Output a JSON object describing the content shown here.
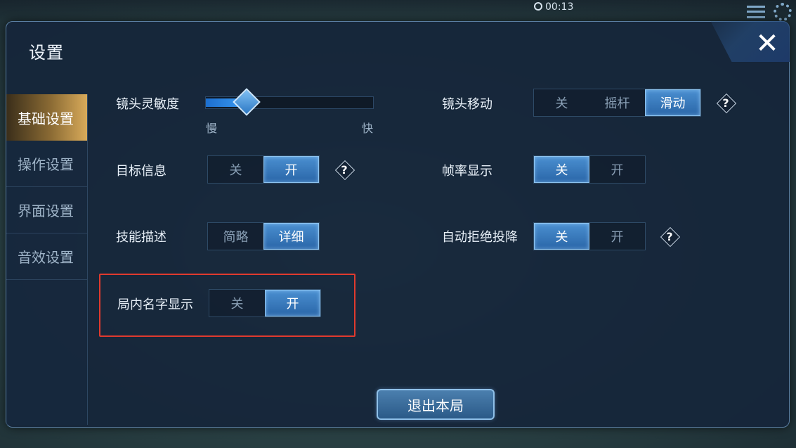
{
  "hud": {
    "timer": "00:13"
  },
  "dialog": {
    "title": "设置",
    "close_label": "✕"
  },
  "sidebar": {
    "items": [
      {
        "label": "基础设置",
        "active": true
      },
      {
        "label": "操作设置",
        "active": false
      },
      {
        "label": "界面设置",
        "active": false
      },
      {
        "label": "音效设置",
        "active": false
      }
    ]
  },
  "settings": {
    "camera_sensitivity": {
      "label": "镜头灵敏度",
      "min_label": "慢",
      "max_label": "快",
      "value": 0.2
    },
    "camera_move": {
      "label": "镜头移动",
      "options": [
        "关",
        "摇杆",
        "滑动"
      ],
      "selected": "滑动",
      "help": "?"
    },
    "target_info": {
      "label": "目标信息",
      "options": [
        "关",
        "开"
      ],
      "selected": "开",
      "help": "?"
    },
    "fps_display": {
      "label": "帧率显示",
      "options": [
        "关",
        "开"
      ],
      "selected": "关"
    },
    "skill_desc": {
      "label": "技能描述",
      "options": [
        "简略",
        "详细"
      ],
      "selected": "详细"
    },
    "auto_reject_surrender": {
      "label": "自动拒绝投降",
      "options": [
        "关",
        "开"
      ],
      "selected": "关",
      "help": "?"
    },
    "ingame_name_display": {
      "label": "局内名字显示",
      "options": [
        "关",
        "开"
      ],
      "selected": "开"
    }
  },
  "exit_button": {
    "label": "退出本局"
  },
  "colors": {
    "accent": "#2a66a8",
    "highlight": "#e03a2e",
    "active_tab": "#d8aa5a"
  }
}
